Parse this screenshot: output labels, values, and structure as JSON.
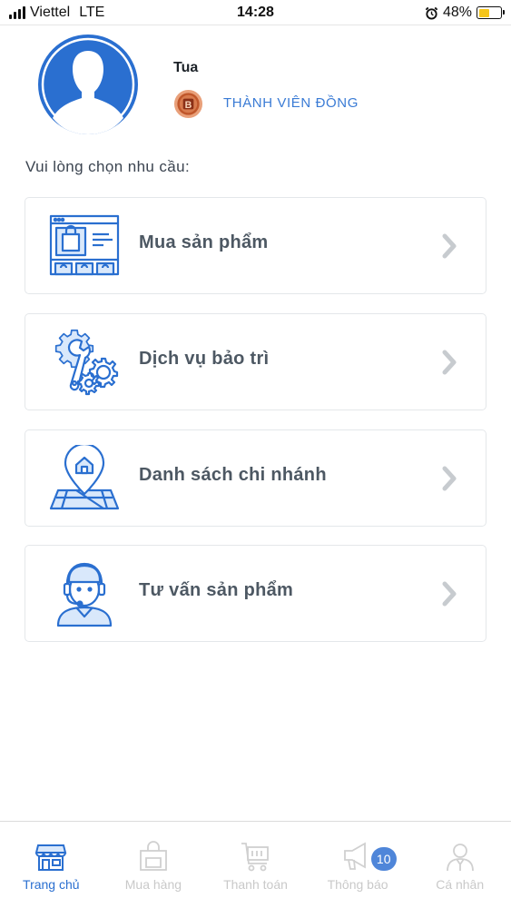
{
  "status_bar": {
    "carrier": "Viettel",
    "network": "LTE",
    "time": "14:28",
    "battery": "48%",
    "battery_level": 0.48,
    "battery_color": "#f5c518"
  },
  "profile": {
    "name": "Tua",
    "member_level": "THÀNH VIÊN ĐỒNG",
    "badge_letter": "B",
    "avatar_icon": "user-silhouette-icon"
  },
  "prompt": "Vui lòng chọn nhu cầu:",
  "options": [
    {
      "label": "Mua sản phẩm",
      "icon": "online-store-icon"
    },
    {
      "label": "Dịch vụ bảo trì",
      "icon": "wrench-gears-icon"
    },
    {
      "label": "Danh sách chi nhánh",
      "icon": "map-pin-icon"
    },
    {
      "label": "Tư vấn sản phẩm",
      "icon": "support-agent-icon"
    }
  ],
  "bottom_nav": [
    {
      "label": "Trang chủ",
      "icon": "storefront-icon",
      "active": true
    },
    {
      "label": "Mua hàng",
      "icon": "shopping-bag-icon",
      "active": false
    },
    {
      "label": "Thanh toán",
      "icon": "cart-icon",
      "active": false
    },
    {
      "label": "Thông báo",
      "icon": "megaphone-icon",
      "active": false,
      "badge": "10"
    },
    {
      "label": "Cá nhân",
      "icon": "person-icon",
      "active": false
    }
  ],
  "colors": {
    "accent": "#2a6fd0",
    "link": "#3a7bd5",
    "inactive": "#c9c9c9",
    "badge": "#4f86d9"
  }
}
